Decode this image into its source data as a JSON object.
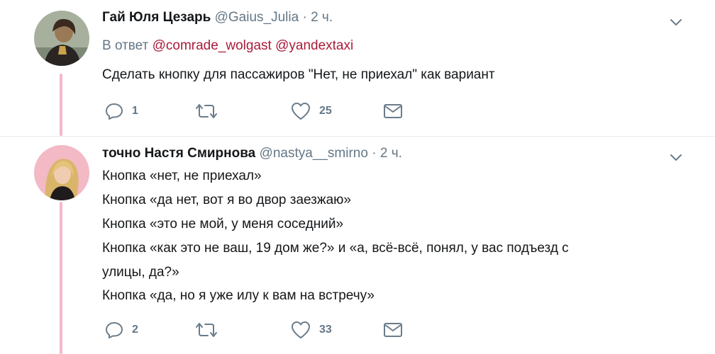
{
  "tweets": [
    {
      "author_name": "Гай Юля Цезарь",
      "handle": "@Gaius_Julia",
      "separator": "·",
      "time": "2 ч.",
      "reply_prefix": "В ответ",
      "mentions": [
        "@comrade_wolgast",
        "@yandextaxi"
      ],
      "text_lines": [
        "Сделать кнопку для пассажиров \"Нет, не приехал\" как вариант"
      ],
      "replies": "1",
      "retweets": "",
      "likes": "25"
    },
    {
      "author_name": "точно Настя Смирнова",
      "handle": "@nastya__smirno",
      "separator": "·",
      "time": "2 ч.",
      "text_lines": [
        "Кнопка «нет, не приехал»",
        "Кнопка «да нет, вот я во двор заезжаю»",
        "Кнопка «это не мой, у меня соседний»",
        "Кнопка «как это не ваш, 19 дом же?» и «а, всё-всё, понял, у вас подъезд с",
        "улицы, да?»",
        "Кнопка «да, но я уже илу к вам на встречу»"
      ],
      "replies": "2",
      "retweets": "",
      "likes": "33"
    }
  ],
  "colors": {
    "thread_line": "#f4b9c8",
    "mention": "#aa1b3a",
    "secondary_text": "#657786",
    "icon": "#6b7c8a",
    "avatar1_bg": "#a7b09d",
    "avatar2_bg": "#f3b9c4"
  },
  "icons": {
    "menu": "chevron-down-icon",
    "reply": "reply-icon",
    "retweet": "retweet-icon",
    "like": "heart-icon",
    "message": "envelope-icon"
  }
}
